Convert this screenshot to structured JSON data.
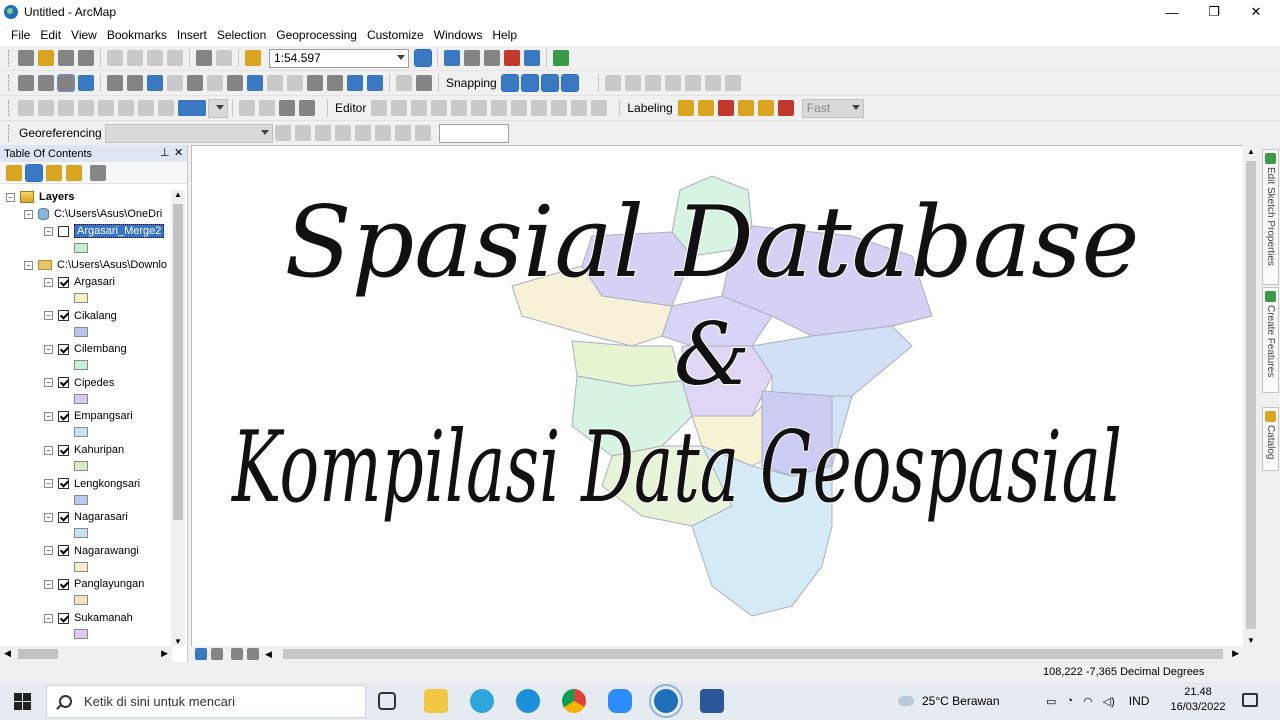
{
  "window": {
    "title": "Untitled - ArcMap",
    "controls": {
      "minimize": "—",
      "maximize": "❐",
      "close": "✕"
    }
  },
  "menu": [
    "File",
    "Edit",
    "View",
    "Bookmarks",
    "Insert",
    "Selection",
    "Geoprocessing",
    "Customize",
    "Windows",
    "Help"
  ],
  "toolbars": {
    "scale": "1:54.597",
    "snapping_label": "Snapping",
    "editor_label": "Editor",
    "labeling_label": "Labeling",
    "fast_label": "Fast",
    "georeferencing_label": "Georeferencing"
  },
  "toc": {
    "title": "Table Of Contents",
    "pin_icon": "pin-icon",
    "close_label": "✕",
    "root_label": "Layers",
    "groups": [
      {
        "path": "C:\\Users\\Asus\\OneDri",
        "icon": "database-icon"
      },
      {
        "path": "C:\\Users\\Asus\\Downlo",
        "icon": "folder-icon"
      }
    ],
    "selected_layer": {
      "name": "Argasari_Merge2",
      "color": "#c5ecd6",
      "checked": false
    },
    "layers": [
      {
        "name": "Argasari",
        "color": "#f5f0c6",
        "checked": true
      },
      {
        "name": "Cikalang",
        "color": "#b8c4f0",
        "checked": true
      },
      {
        "name": "Cilembang",
        "color": "#c9f0d9",
        "checked": true
      },
      {
        "name": "Cipedes",
        "color": "#dcc6f2",
        "checked": true
      },
      {
        "name": "Empangsari",
        "color": "#c6e3f5",
        "checked": true
      },
      {
        "name": "Kahuripan",
        "color": "#d6f0c4",
        "checked": true
      },
      {
        "name": "Lengkongsari",
        "color": "#b6caf0",
        "checked": true
      },
      {
        "name": "Nagarasari",
        "color": "#c6e3f2",
        "checked": true
      },
      {
        "name": "Nagarawangi",
        "color": "#f5f0c6",
        "checked": true
      },
      {
        "name": "Panglayungan",
        "color": "#f5e3c2",
        "checked": true
      },
      {
        "name": "Sukamanah",
        "color": "#e2c9f2",
        "checked": true
      }
    ]
  },
  "map": {
    "overlay_line1": "Spasial Database",
    "overlay_line2": "&",
    "overlay_line3": "Kompilasi Data Geospasial"
  },
  "side_tabs": [
    "Edit Sketch Properties",
    "Create Features",
    "Catalog"
  ],
  "status": {
    "coords": "108,222  -7,365 Decimal Degrees"
  },
  "taskbar": {
    "search_placeholder": "Ketik di sini untuk mencari",
    "weather": "25°C  Berawan",
    "language": "IND",
    "time": "21.48",
    "date": "16/03/2022"
  }
}
